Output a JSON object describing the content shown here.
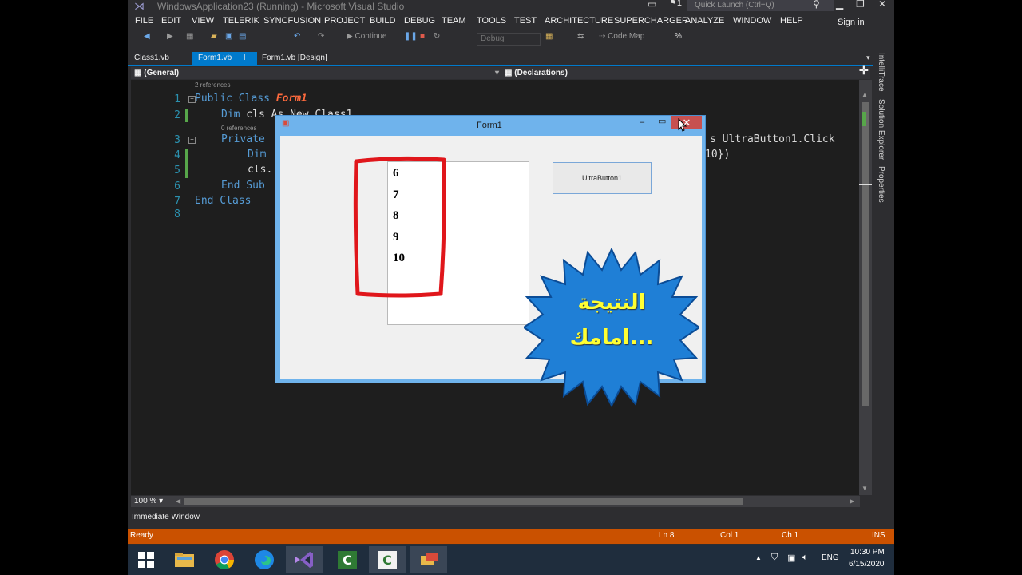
{
  "window": {
    "title": "WindowsApplication23 (Running) - Microsoft Visual Studio",
    "quick_launch_placeholder": "Quick Launch (Ctrl+Q)",
    "notification_count": "1",
    "sign_in": "Sign in"
  },
  "menu": [
    "FILE",
    "EDIT",
    "VIEW",
    "TELERIK",
    "SYNCFUSION",
    "PROJECT",
    "BUILD",
    "DEBUG",
    "TEAM",
    "TOOLS",
    "TEST",
    "ARCHITECTURE",
    "SUPERCHARGER",
    "ANALYZE",
    "WINDOW",
    "HELP"
  ],
  "toolbar": {
    "continue_label": "Continue",
    "config_value": "Debug",
    "code_map_label": "Code Map"
  },
  "tabs": [
    {
      "label": "Class1.vb"
    },
    {
      "label": "Form1.vb"
    },
    {
      "label": "Form1.vb [Design]"
    }
  ],
  "nav": {
    "left": "(General)",
    "right": "(Declarations)"
  },
  "editor": {
    "refs_2": "2 references",
    "refs_0": "0 references",
    "line_numbers": [
      "1",
      "2",
      "3",
      "4",
      "5",
      "6",
      "7",
      "8"
    ],
    "lines": {
      "l1_kw": "Public Class ",
      "l1_name": "Form1",
      "l2_kw": "Dim",
      "l2_rest": " cls As New Class1",
      "l3_kw": "Private",
      "l3_tail": "s UltraButton1.Click",
      "l4_kw": "Dim",
      "l4_tail": "10})",
      "l5": "cls.",
      "l6": "End Sub",
      "l7": "End Class"
    }
  },
  "right_panel_tabs": [
    "IntelliTrace",
    "Solution Explorer",
    "Properties"
  ],
  "zoom": "100 %",
  "immediate_window": "Immediate Window",
  "status": {
    "ready": "Ready",
    "ln": "Ln 8",
    "col": "Col 1",
    "ch": "Ch 1",
    "ins": "INS"
  },
  "form1": {
    "title": "Form1",
    "list_items": [
      "6",
      "7",
      "8",
      "9",
      "10"
    ],
    "button_label": "UltraButton1"
  },
  "annotation": {
    "line1": "النتيجة",
    "line2": "امامك..."
  },
  "taskbar": {
    "language": "ENG",
    "time": "10:30 PM",
    "date": "6/15/2020"
  },
  "colors": {
    "accent": "#007acc",
    "status_bar": "#ca5100",
    "highlight_box": "#e0161b",
    "starburst": "#1f7fd6"
  }
}
